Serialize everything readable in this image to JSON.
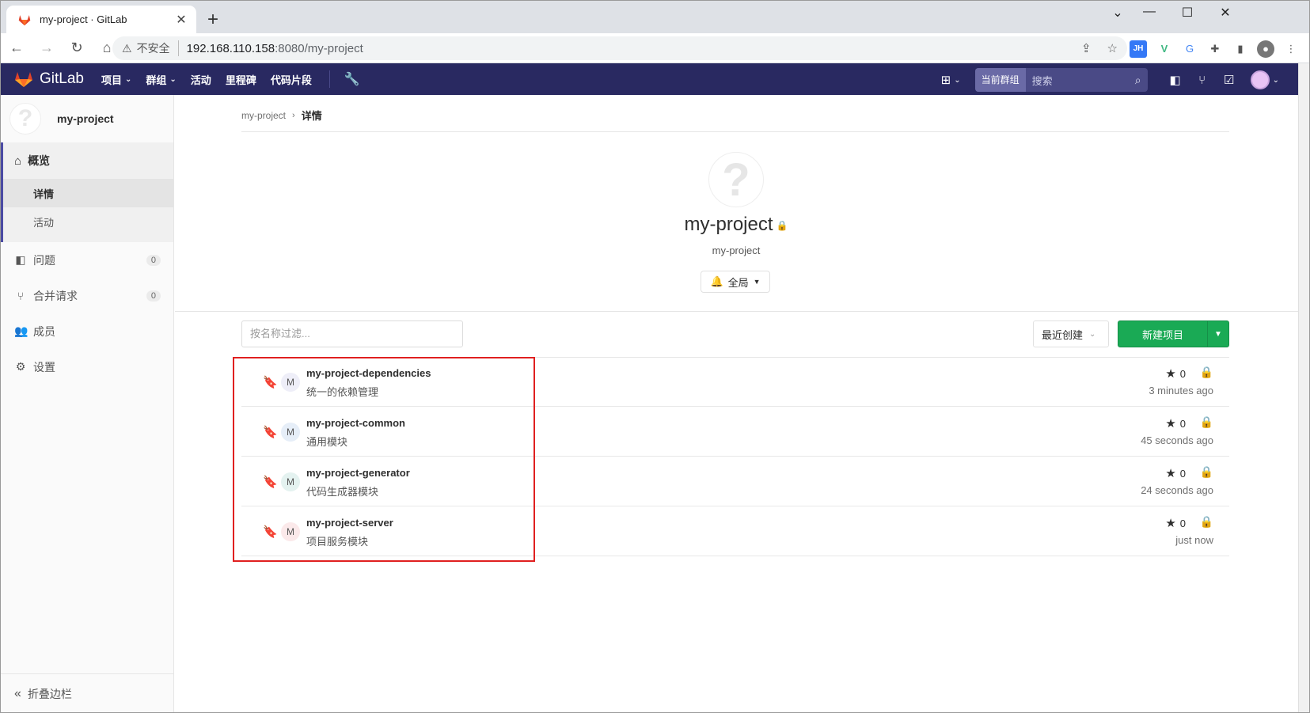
{
  "browser": {
    "tab_title": "my-project · GitLab",
    "insecure_label": "不安全",
    "url_host": "192.168.110.158",
    "url_path": ":8080/my-project"
  },
  "header": {
    "brand": "GitLab",
    "nav": [
      "项目",
      "群组",
      "活动",
      "里程碑",
      "代码片段"
    ],
    "search_scope": "当前群组",
    "search_placeholder": "搜索"
  },
  "sidebar": {
    "project_name": "my-project",
    "overview_label": "概览",
    "overview_sub": [
      "详情",
      "活动"
    ],
    "items": [
      {
        "label": "问题",
        "badge": "0"
      },
      {
        "label": "合并请求",
        "badge": "0"
      },
      {
        "label": "成员",
        "badge": ""
      },
      {
        "label": "设置",
        "badge": ""
      }
    ],
    "collapse_label": "折叠边栏"
  },
  "breadcrumb": {
    "parent": "my-project",
    "current": "详情"
  },
  "group": {
    "title": "my-project",
    "path": "my-project",
    "notification_label": "全局"
  },
  "controls": {
    "filter_placeholder": "按名称过滤...",
    "sort_label": "最近创建",
    "new_project_label": "新建项目"
  },
  "projects": [
    {
      "name": "my-project-dependencies",
      "desc": "统一的依赖管理",
      "stars": "0",
      "time": "3 minutes ago",
      "letter": "M",
      "avatar_color": "#eeeef8"
    },
    {
      "name": "my-project-common",
      "desc": "通用模块",
      "stars": "0",
      "time": "45 seconds ago",
      "letter": "M",
      "avatar_color": "#e6eef8"
    },
    {
      "name": "my-project-generator",
      "desc": "代码生成器模块",
      "stars": "0",
      "time": "24 seconds ago",
      "letter": "M",
      "avatar_color": "#e4f2f0"
    },
    {
      "name": "my-project-server",
      "desc": "项目服务模块",
      "stars": "0",
      "time": "just now",
      "letter": "M",
      "avatar_color": "#fbe9ea"
    }
  ],
  "colors": {
    "header_bg": "#292961",
    "accent_sidebar": "#4b4ba3",
    "new_project_green": "#1aaa55",
    "highlight_red": "#e02020"
  }
}
